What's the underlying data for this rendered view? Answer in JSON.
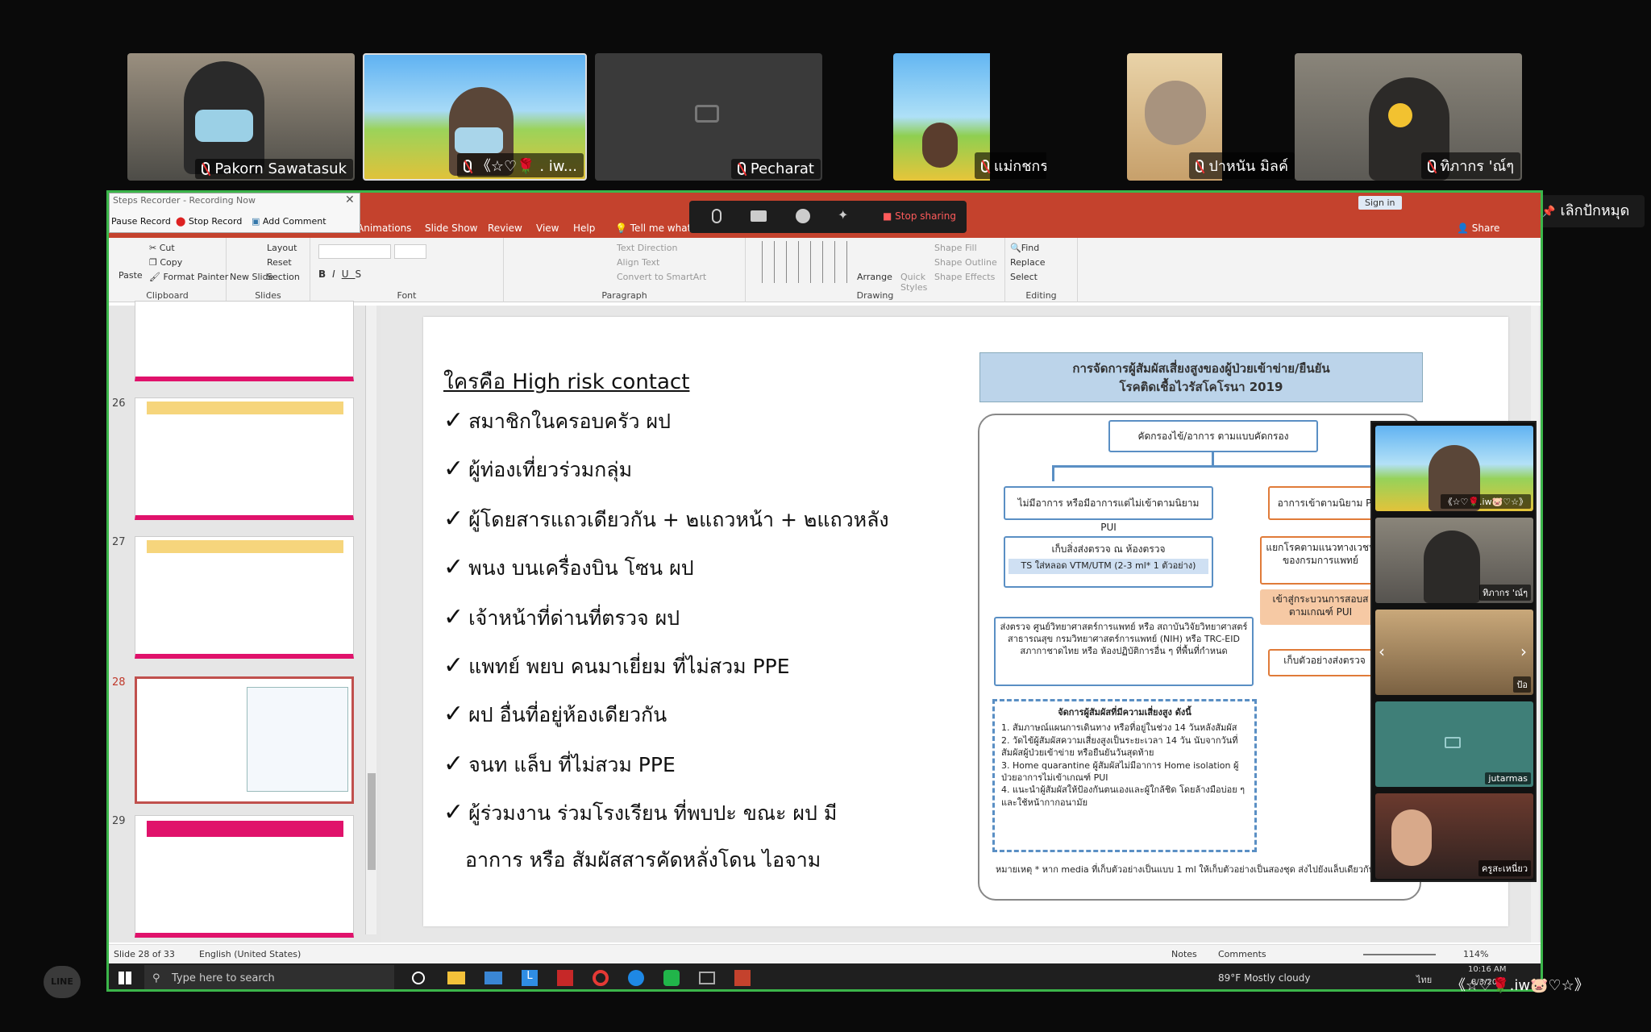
{
  "participants": [
    {
      "name": "Pakorn Sawatasuk"
    },
    {
      "name": "《☆♡🌹 . iw..."
    },
    {
      "name": "Pecharat"
    },
    {
      "name": "แม่กชกร"
    },
    {
      "name": "ปาหนัน มิลค์"
    },
    {
      "name": "ทิภากร 'ณ์ๆ"
    }
  ],
  "pin_button": {
    "label": "เลิกปักหมุด"
  },
  "steps_recorder": {
    "title": "Steps Recorder - Recording Now",
    "pause": "Pause Record",
    "stop": "Stop Record",
    "add_comment": "Add Comment"
  },
  "share_toolbar": {
    "stop_sharing": "Stop sharing"
  },
  "ppt": {
    "sign_in": "Sign in",
    "share": "Share",
    "menu": [
      "Animations",
      "Slide Show",
      "Review",
      "View",
      "Help",
      "Tell me what"
    ],
    "clipboard": {
      "paste": "Paste",
      "cut": "Cut",
      "copy": "Copy",
      "format_painter": "Format Painter",
      "label": "Clipboard"
    },
    "slides": {
      "new_slide": "New Slide",
      "layout": "Layout",
      "reset": "Reset",
      "section": "Section",
      "label": "Slides"
    },
    "font": {
      "label": "Font"
    },
    "paragraph": {
      "text_direction": "Text Direction",
      "align_text": "Align Text",
      "convert": "Convert to SmartArt",
      "label": "Paragraph"
    },
    "drawing": {
      "arrange": "Arrange",
      "quick_styles": "Quick Styles",
      "shape_fill": "Shape Fill",
      "shape_outline": "Shape Outline",
      "shape_effects": "Shape Effects",
      "label": "Drawing"
    },
    "editing": {
      "find": "Find",
      "replace": "Replace",
      "select": "Select",
      "label": "Editing"
    },
    "thumb_numbers": [
      "26",
      "27",
      "28",
      "29"
    ],
    "status": {
      "slide": "Slide 28 of 33",
      "language": "English (United States)",
      "notes": "Notes",
      "comments": "Comments",
      "zoom": "114%"
    }
  },
  "slide": {
    "heading": "ใครคือ High risk contact",
    "bullets": [
      "สมาชิกในครอบครัว ผป",
      "ผู้ท่องเที่ยวร่วมกลุ่ม",
      "ผู้โดยสารแถวเดียวกัน + ๒แถวหน้า + ๒แถวหลัง",
      "พนง บนเครื่องบิน โซน ผป",
      "เจ้าหน้าที่ด่านที่ตรวจ ผป",
      "แพทย์ พยบ คนมาเยี่ยม ที่ไม่สวม PPE",
      "ผป อื่นที่อยู่ห้องเดียวกัน",
      "จนท แล็บ ที่ไม่สวม PPE",
      "ผู้ร่วมงาน ร่วมโรงเรียน ที่พบปะ ขณะ ผป มี"
    ],
    "bullet_cont": "อาการ หรือ สัมผัสสารคัดหลั่งโดน ไอจาม",
    "flow": {
      "title1": "การจัดการผู้สัมผัสเสี่ยงสูงของผู้ป่วยเข้าข่าย/ยืนยัน",
      "title2": "โรคติดเชื้อไวรัสโคโรนา 2019",
      "screen": "คัดกรองไข้/อาการ ตามแบบคัดกรอง",
      "left1": "ไม่มีอาการ หรือมีอาการแต่ไม่เข้าตามนิยาม PUI",
      "right1": "อาการเข้าตามนิยาม P",
      "collect": "เก็บสิ่งส่งตรวจ ณ ห้องตรวจ",
      "ts": "TS ใส่หลอด VTM/UTM (2-3 ml* 1 ตัวอย่าง)",
      "right2": "แยกโรคตามแนวทางเวชป ของกรมการแพทย์",
      "right3": "เข้าสู่กระบวนการสอบส ตามเกณฑ์ PUI",
      "right4": "เก็บตัวอย่างส่งตรวจ",
      "lab": "ส่งตรวจ ศูนย์วิทยาศาสตร์การแพทย์ หรือ สถาบันวิจัยวิทยาศาสตร์สาธารณสุข กรมวิทยาศาสตร์การแพทย์ (NIH) หรือ TRC-EID สภากาชาดไทย หรือ ห้องปฏิบัติการอื่น ๆ ที่พื้นที่กำหนด",
      "manage_title": "จัดการผู้สัมผัสที่มีความเสี่ยงสูง ดังนี้",
      "manage_items": [
        "1. สัมภาษณ์แผนการเดินทาง หรือที่อยู่ในช่วง 14 วันหลังสัมผัส",
        "2. วัดไข้ผู้สัมผัสความเสี่ยงสูงเป็นระยะเวลา 14 วัน นับจากวันที่สัมผัสผู้ป่วยเข้าข่าย หรือยืนยันวันสุดท้าย",
        "3. Home quarantine ผู้สัมผัสไม่มีอาการ Home isolation ผู้ป่วยอาการไม่เข้าเกณฑ์ PUI",
        "4. แนะนำผู้สัมผัสให้ป้องกันตนเองและผู้ใกล้ชิด โดยล้างมือบ่อย ๆ และใช้หน้ากากอนามัย"
      ],
      "note": "หมายเหตุ * หาก media ที่เก็บตัวอย่างเป็นแบบ 1 ml ให้เก็บตัวอย่างเป็นสองชุด ส่งไปยังแล็บเดียวกัน"
    }
  },
  "side_videos": [
    {
      "name": "《☆♡🌹.iw🐷♡☆》"
    },
    {
      "name": "ทิภากร 'ณ์ๆ"
    },
    {
      "name": "ป้อ"
    },
    {
      "name": "jutarmas"
    },
    {
      "name": "ครูสะเหนี่ยว"
    }
  ],
  "taskbar": {
    "search": "Type here to search",
    "weather": "89°F  Mostly cloudy",
    "time": "10:16 AM",
    "date": "8/3/20",
    "lang": "ไทย"
  },
  "bottom_name": "《☆♡🌹.iw🐷♡☆》",
  "line_logo": "LINE"
}
